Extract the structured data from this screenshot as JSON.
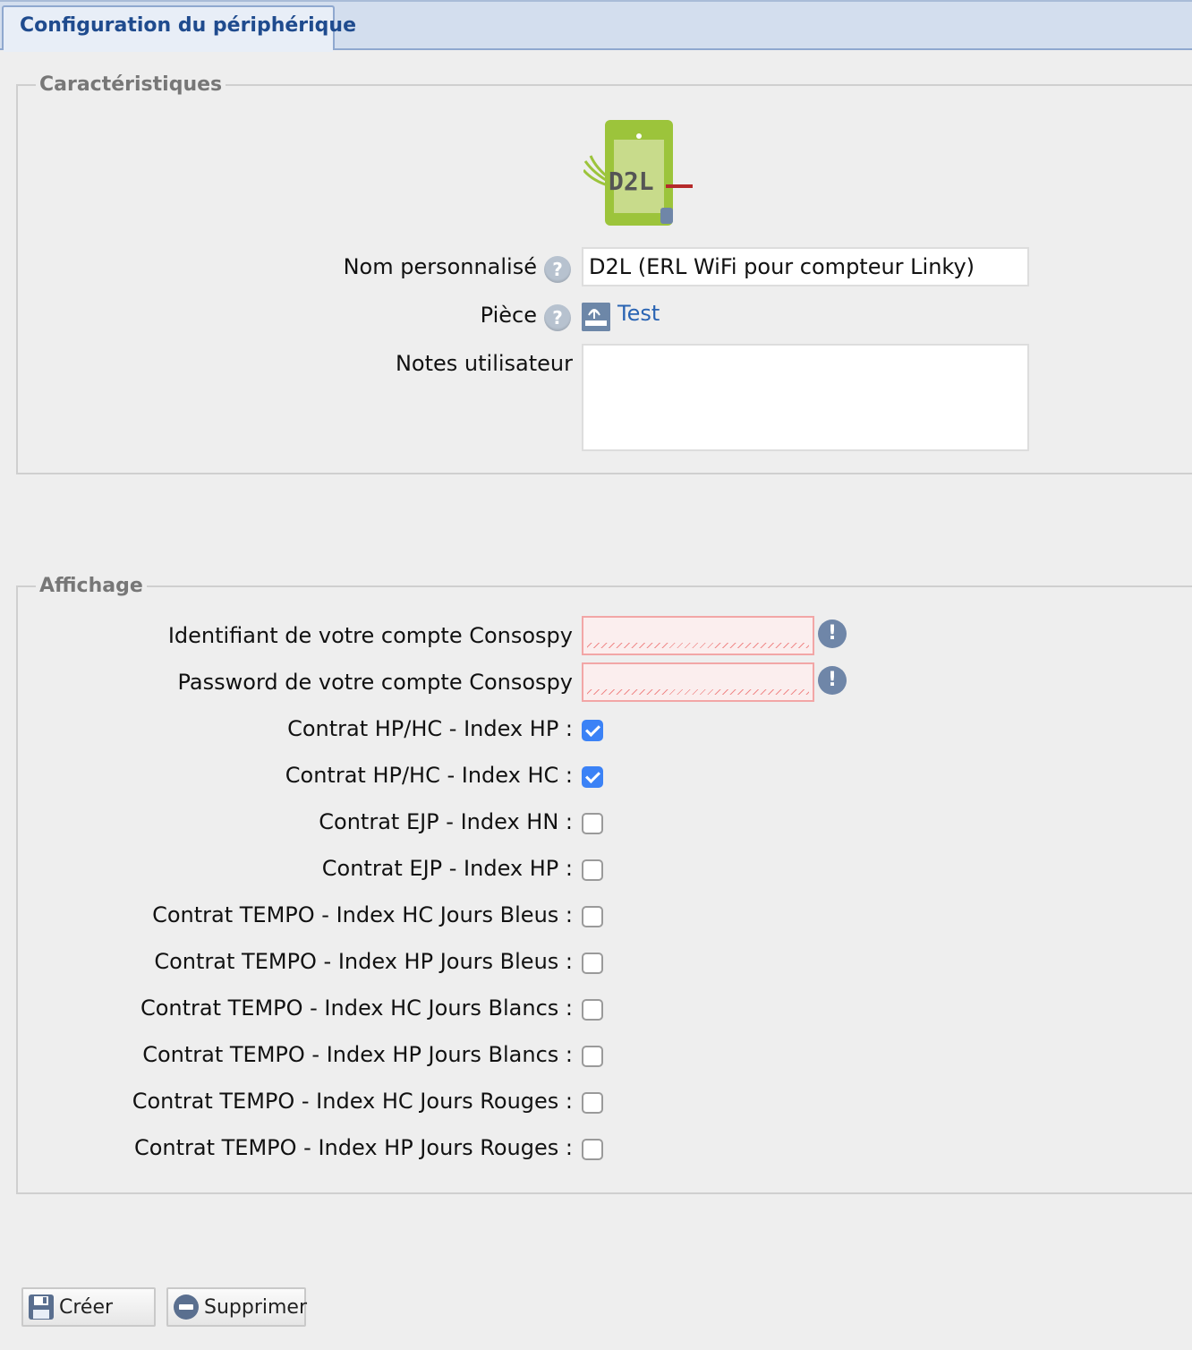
{
  "tab": {
    "label": "Configuration du périphérique"
  },
  "caracteristiques": {
    "legend": "Caractéristiques",
    "logo_text": "D2L",
    "nom_label": "Nom personnalisé",
    "nom_value": "D2L (ERL WiFi pour compteur Linky)",
    "piece_label": "Pièce",
    "piece_value": "Test",
    "notes_label": "Notes utilisateur",
    "notes_value": ""
  },
  "affichage": {
    "legend": "Affichage",
    "identifiant_label": "Identifiant de votre compte Consospy",
    "password_label": "Password de votre compte Consospy",
    "checkboxes": [
      {
        "label": "Contrat HP/HC - Index HP :",
        "checked": true
      },
      {
        "label": "Contrat HP/HC - Index HC :",
        "checked": true
      },
      {
        "label": "Contrat EJP - Index HN :",
        "checked": false
      },
      {
        "label": "Contrat EJP - Index HP :",
        "checked": false
      },
      {
        "label": "Contrat TEMPO - Index HC Jours Bleus :",
        "checked": false
      },
      {
        "label": "Contrat TEMPO - Index HP Jours Bleus :",
        "checked": false
      },
      {
        "label": "Contrat TEMPO - Index HC Jours Blancs :",
        "checked": false
      },
      {
        "label": "Contrat TEMPO - Index HP Jours Blancs :",
        "checked": false
      },
      {
        "label": "Contrat TEMPO - Index HC Jours Rouges :",
        "checked": false
      },
      {
        "label": "Contrat TEMPO - Index HP Jours Rouges :",
        "checked": false
      }
    ]
  },
  "buttons": {
    "create_label": "Créer",
    "delete_label": "Supprimer"
  },
  "icons": {
    "help": "help-icon",
    "warning": "warning-icon",
    "room": "room-icon",
    "save": "floppy-disk-icon",
    "delete": "minus-circle-icon"
  },
  "colors": {
    "tab_text": "#1f4b8e",
    "link": "#2a64b3",
    "checkbox_checked": "#3b82f6",
    "error_bg": "#fbeeee",
    "error_border": "#f2a6a6",
    "logo_green": "#9cc43b",
    "logo_red": "#b52a2a"
  }
}
